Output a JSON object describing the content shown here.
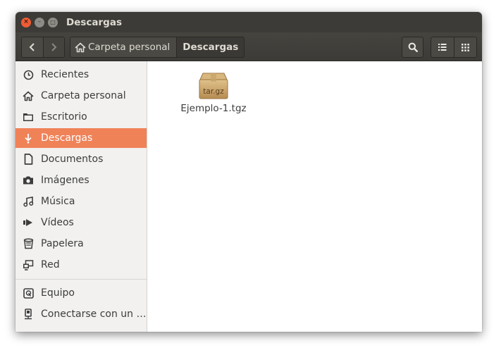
{
  "window": {
    "title": "Descargas"
  },
  "window_controls": {
    "close_glyph": "×",
    "minimize_glyph": "–",
    "maximize_glyph": "□"
  },
  "toolbar": {
    "back_glyph": "‹",
    "forward_glyph": "›",
    "breadcrumbs": [
      {
        "label": "Carpeta personal",
        "icon": "home-icon"
      },
      {
        "label": "Descargas"
      }
    ],
    "search_icon": "search-icon",
    "list_view_icon": "list-view-icon",
    "grid_view_icon": "grid-view-icon"
  },
  "sidebar": {
    "items": [
      {
        "label": "Recientes",
        "icon": "clock-icon"
      },
      {
        "label": "Carpeta personal",
        "icon": "home-icon"
      },
      {
        "label": "Escritorio",
        "icon": "folder-icon"
      },
      {
        "label": "Descargas",
        "icon": "download-icon",
        "active": true
      },
      {
        "label": "Documentos",
        "icon": "document-icon"
      },
      {
        "label": "Imágenes",
        "icon": "camera-icon"
      },
      {
        "label": "Música",
        "icon": "music-icon"
      },
      {
        "label": "Vídeos",
        "icon": "video-icon"
      },
      {
        "label": "Papelera",
        "icon": "trash-icon"
      },
      {
        "label": "Red",
        "icon": "network-icon"
      },
      {
        "label": "Equipo",
        "icon": "drive-icon"
      },
      {
        "label": "Conectarse con un …",
        "icon": "server-icon"
      }
    ]
  },
  "files": [
    {
      "name": "Ejemplo-1.tgz",
      "icon_label": "tar.gz",
      "icon": "archive-icon"
    }
  ],
  "colors": {
    "titlebar": "#3c3b37",
    "accent": "#f08258",
    "close_button": "#ef5c35",
    "sidebar_bg": "#f2f1f0"
  }
}
